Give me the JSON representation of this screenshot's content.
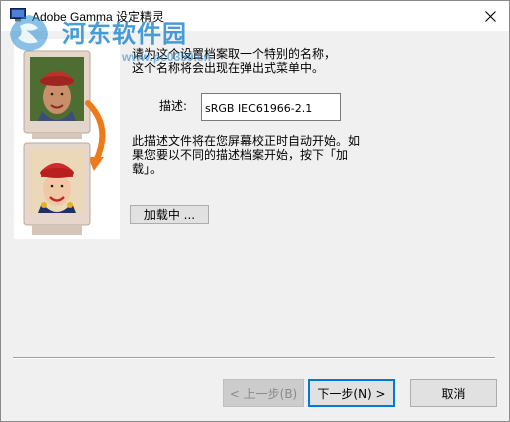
{
  "window": {
    "title": "Adobe Gamma 设定精灵",
    "close_symbol": "✕"
  },
  "watermark": {
    "brand": "河东软件园",
    "url": "www.pc0359.cn"
  },
  "content": {
    "intro_line1": "请为这个设置档案取一个特别的名称，",
    "intro_line2": "这个名称将会出现在弹出式菜单中。",
    "description_label": "描述:",
    "description_value": "sRGB IEC61966-2.1",
    "info_line1": "此描述文件将在您屏幕校正时自动开始。如",
    "info_line2": "果您要以不同的描述档案开始，按下「加",
    "info_line3": "载」。",
    "load_button": "加载中 ..."
  },
  "footer": {
    "back_button": "< 上一步(B)",
    "next_button": "下一步(N) >",
    "cancel_button": "取消"
  },
  "colors": {
    "dialog_bg": "#f0f0f0",
    "focus_border": "#0078d7",
    "watermark_blue": "#288cd2",
    "arrow_orange": "#ee7a1a",
    "monitor_frame": "#d8c8bc"
  },
  "icons": {
    "app_icon": "monitor-icon",
    "close": "close-icon",
    "arrow": "curved-arrow-icon"
  }
}
